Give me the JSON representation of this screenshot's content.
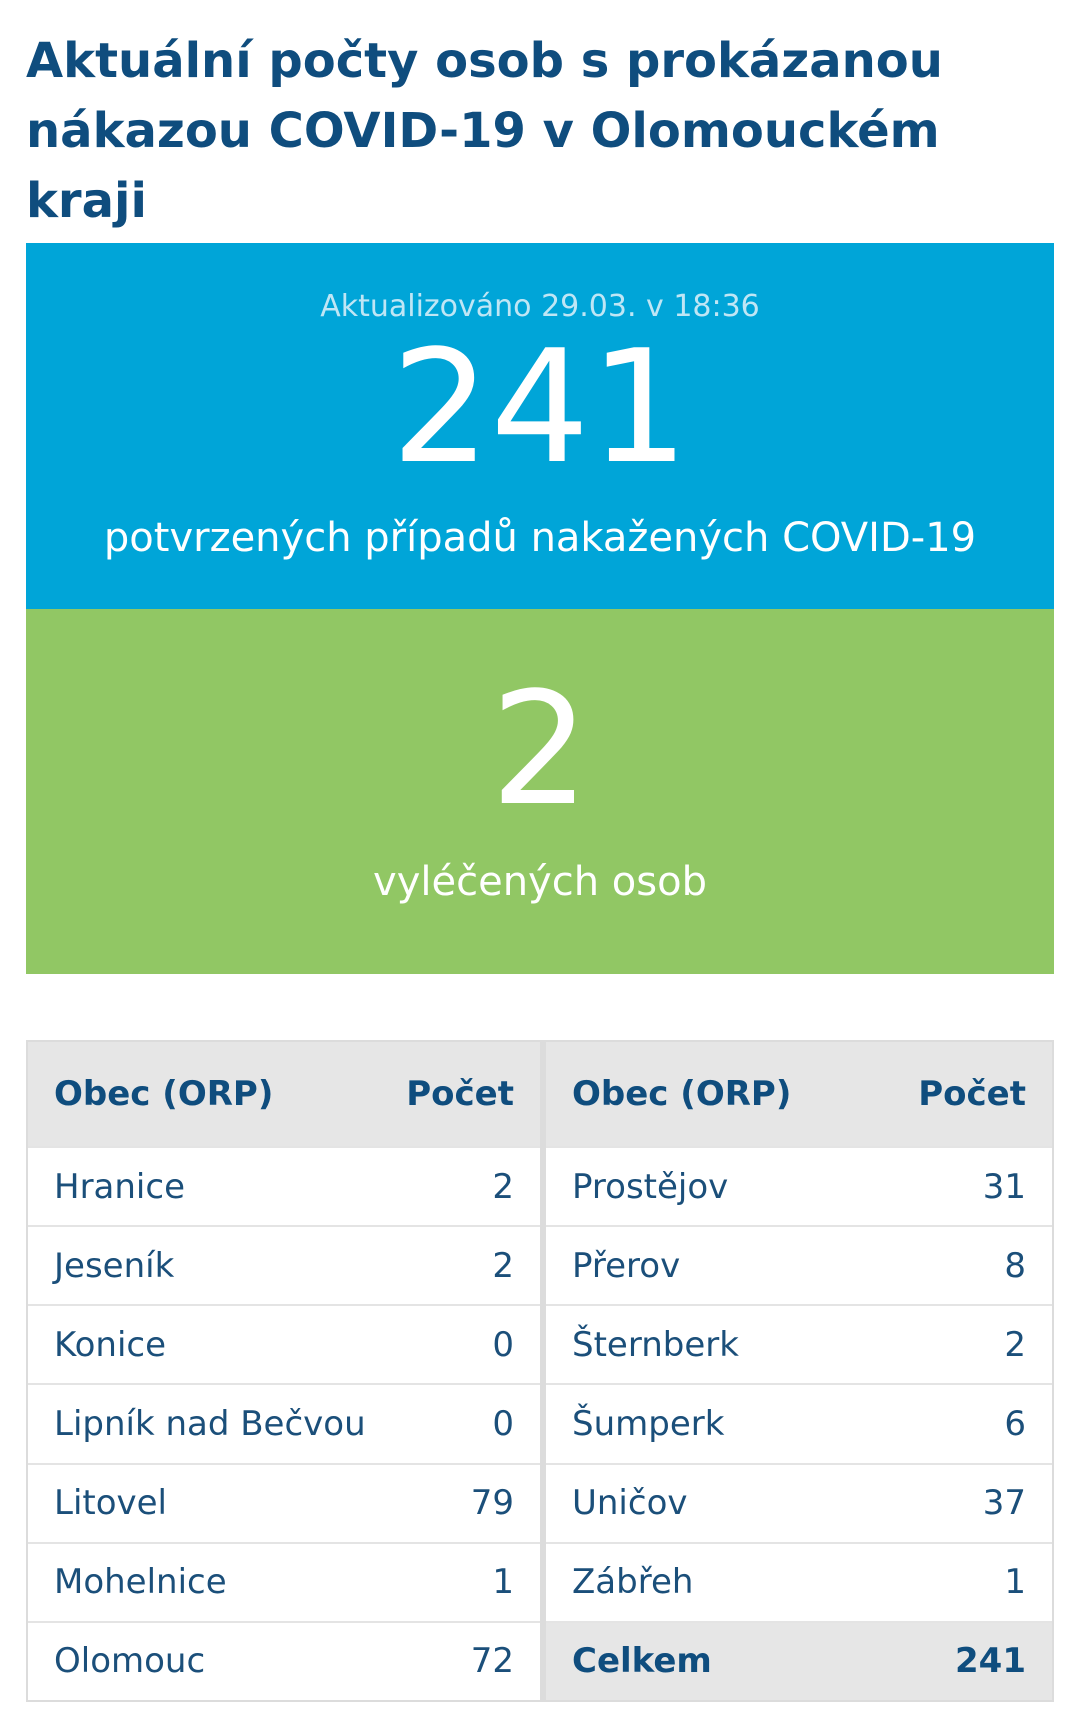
{
  "title": "Aktuální počty osob s prokázanou nákazou COVID-19 v Olomouckém kraji",
  "confirmed": {
    "updated": "Aktualizováno 29.03. v 18:36",
    "count": "241",
    "caption": "potvrzených případů nakažených COVID-19",
    "color": "#00a5d8"
  },
  "recovered": {
    "count": "2",
    "caption": "vyléčených osob",
    "color": "#91c764"
  },
  "table_left": {
    "header_name": "Obec (ORP)",
    "header_count": "Počet",
    "rows": [
      {
        "name": "Hranice",
        "count": "2"
      },
      {
        "name": "Jeseník",
        "count": "2"
      },
      {
        "name": "Konice",
        "count": "0"
      },
      {
        "name": "Lipník nad Bečvou",
        "count": "0"
      },
      {
        "name": "Litovel",
        "count": "79"
      },
      {
        "name": "Mohelnice",
        "count": "1"
      },
      {
        "name": "Olomouc",
        "count": "72"
      }
    ]
  },
  "table_right": {
    "header_name": "Obec (ORP)",
    "header_count": "Počet",
    "rows": [
      {
        "name": "Prostějov",
        "count": "31"
      },
      {
        "name": "Přerov",
        "count": "8"
      },
      {
        "name": "Šternberk",
        "count": "2"
      },
      {
        "name": "Šumperk",
        "count": "6"
      },
      {
        "name": "Uničov",
        "count": "37"
      },
      {
        "name": "Zábřeh",
        "count": "1"
      }
    ],
    "total_label": "Celkem",
    "total_count": "241"
  }
}
